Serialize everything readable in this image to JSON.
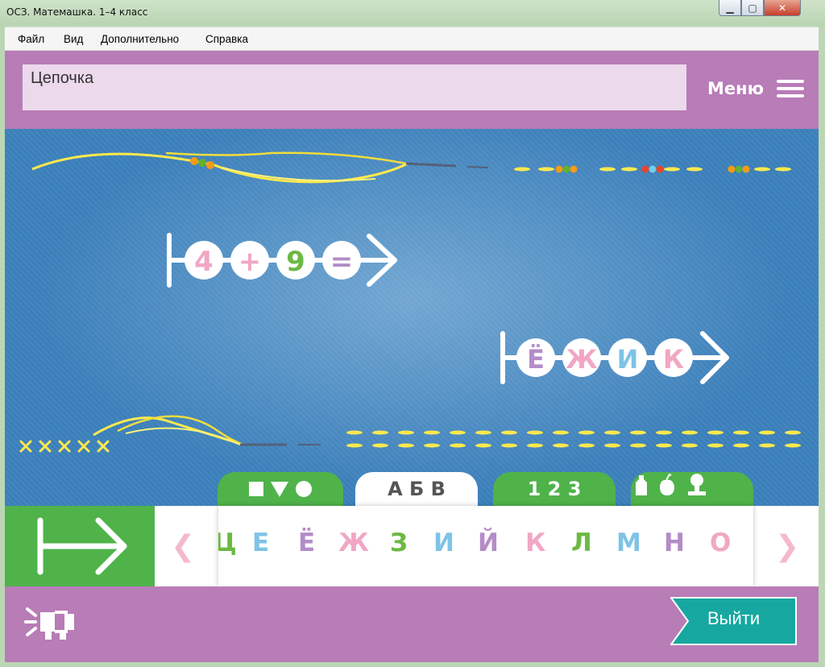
{
  "window": {
    "title": "ОСЗ. Матемашка. 1–4 класс",
    "minimize": "▁",
    "maximize": "▢",
    "close": "✕"
  },
  "menubar": {
    "items": [
      "Файл",
      "Вид",
      "Дополнительно",
      "Справка"
    ]
  },
  "header": {
    "title": "Цепочка",
    "menu_label": "Меню"
  },
  "chains": {
    "math": {
      "items": [
        {
          "text": "4",
          "color": "#f1a7c4"
        },
        {
          "text": "+",
          "color": "#f1a7c4"
        },
        {
          "text": "9",
          "color": "#6cb944"
        },
        {
          "text": "=",
          "color": "#b48cc8"
        }
      ]
    },
    "word": {
      "items": [
        {
          "text": "Ё",
          "color": "#b48cc8"
        },
        {
          "text": "Ж",
          "color": "#f1a7c4"
        },
        {
          "text": "И",
          "color": "#7fc3e6"
        },
        {
          "text": "К",
          "color": "#f1a7c4"
        }
      ]
    }
  },
  "tabs": [
    {
      "id": "shapes",
      "label": "■▼●",
      "active": false
    },
    {
      "id": "letters",
      "label": "А Б В",
      "active": true
    },
    {
      "id": "numbers",
      "label": "1 2 3",
      "active": false
    },
    {
      "id": "objects",
      "label": "objects-icons",
      "active": false
    }
  ],
  "palette": {
    "letters": [
      {
        "text": "Ц",
        "color": "#6cb944"
      },
      {
        "text": "Е",
        "color": "#7fc3e6"
      },
      {
        "text": "Ё",
        "color": "#b48cc8"
      },
      {
        "text": "Ж",
        "color": "#f1a7c4"
      },
      {
        "text": "З",
        "color": "#6cb944"
      },
      {
        "text": "И",
        "color": "#7fc3e6"
      },
      {
        "text": "Й",
        "color": "#b48cc8"
      },
      {
        "text": "К",
        "color": "#f1a7c4"
      },
      {
        "text": "Л",
        "color": "#6cb944"
      },
      {
        "text": "М",
        "color": "#7fc3e6"
      },
      {
        "text": "Н",
        "color": "#b48cc8"
      },
      {
        "text": "О",
        "color": "#f1a7c4"
      }
    ],
    "prev": "❮",
    "next": "❯"
  },
  "footer": {
    "exit_label": "Выйти"
  },
  "colors": {
    "header": "#b87cb7",
    "green": "#4fb34a",
    "teal": "#16a8a0",
    "work_bg": "#3b7fba"
  }
}
